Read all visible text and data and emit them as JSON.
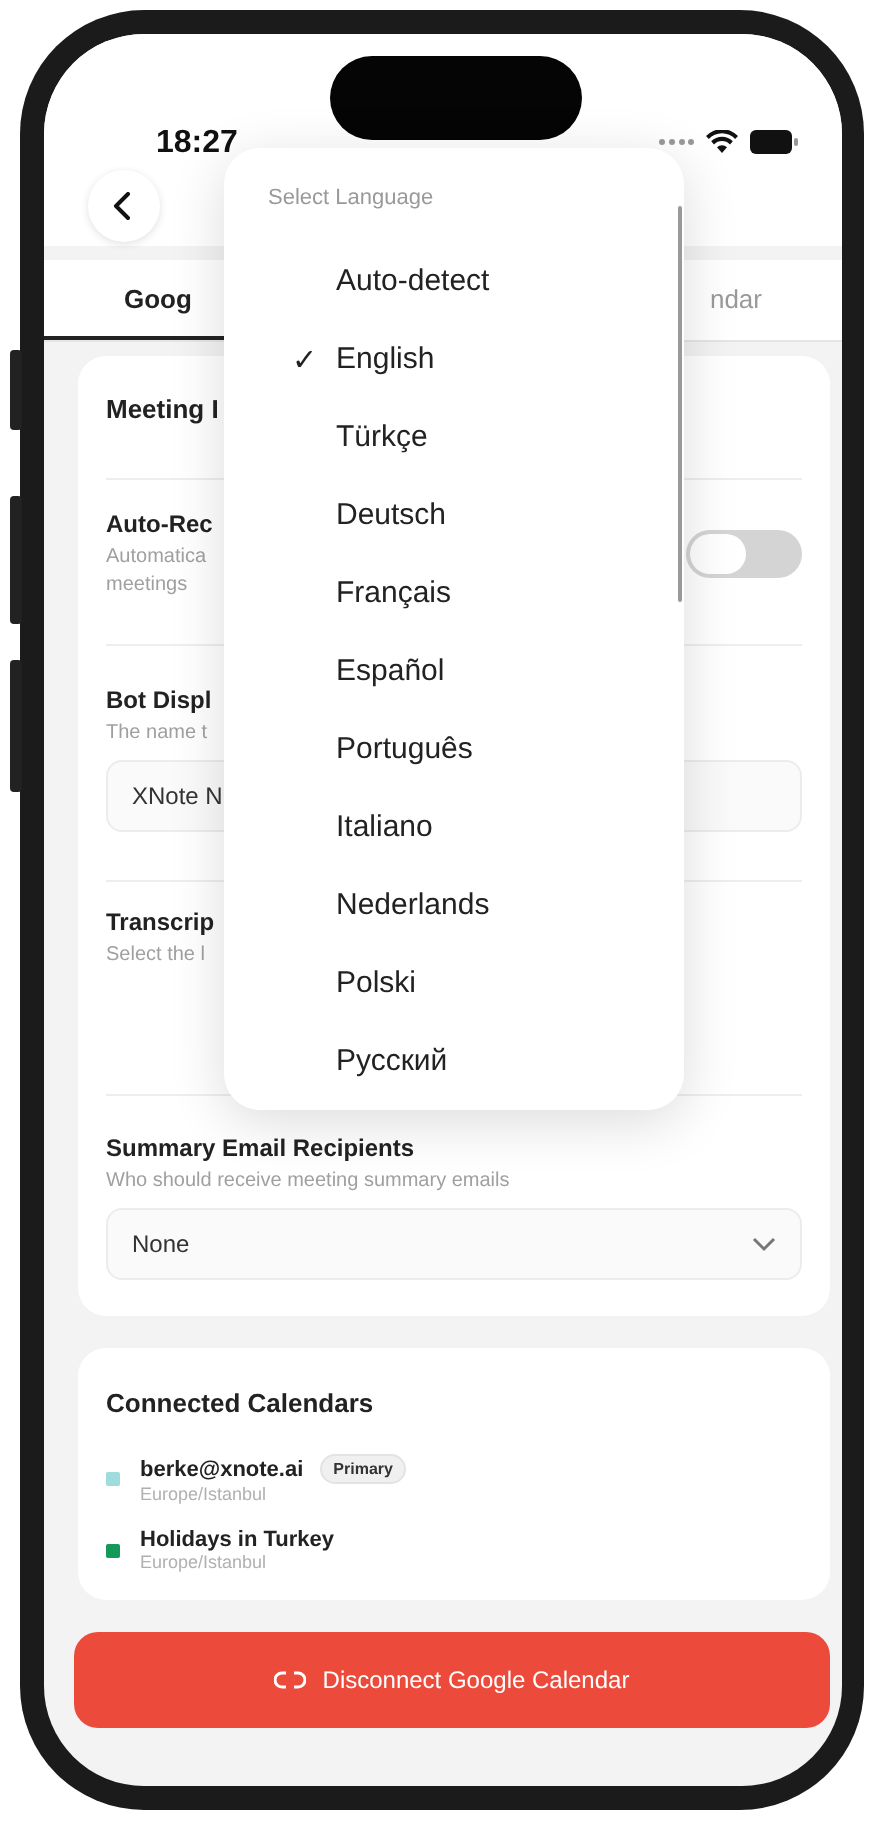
{
  "status_bar": {
    "time": "18:27"
  },
  "tabs": [
    {
      "label": "Goog",
      "selected": true
    },
    {
      "label": "ndar",
      "selected": false
    }
  ],
  "settings_card": {
    "title": "Meeting I",
    "auto_record": {
      "label": "Auto-Rec",
      "description_lines": [
        "Automatica",
        "meetings"
      ],
      "on": false
    },
    "bot_name": {
      "label": "Bot Displ",
      "description": "The name t",
      "value": "XNote N"
    },
    "transcription": {
      "label": "Transcrip",
      "description": "Select the l"
    },
    "summary": {
      "label": "Summary Email Recipients",
      "description": "Who should receive meeting summary emails",
      "value": "None"
    }
  },
  "calendars": {
    "title": "Connected Calendars",
    "items": [
      {
        "name": "berke@xnote.ai",
        "badge": "Primary",
        "timezone": "Europe/Istanbul",
        "color": "#9fdcdc"
      },
      {
        "name": "Holidays in Turkey",
        "timezone": "Europe/Istanbul",
        "color": "#14995a"
      }
    ]
  },
  "disconnect_button": {
    "label": "Disconnect Google Calendar"
  },
  "language_menu": {
    "title": "Select Language",
    "check": "✓",
    "options": [
      {
        "label": "Auto-detect",
        "selected": false
      },
      {
        "label": "English",
        "selected": true
      },
      {
        "label": "Türkçe",
        "selected": false
      },
      {
        "label": "Deutsch",
        "selected": false
      },
      {
        "label": "Français",
        "selected": false
      },
      {
        "label": "Español",
        "selected": false
      },
      {
        "label": "Português",
        "selected": false
      },
      {
        "label": "Italiano",
        "selected": false
      },
      {
        "label": "Nederlands",
        "selected": false
      },
      {
        "label": "Polski",
        "selected": false
      },
      {
        "label": "Русский",
        "selected": false
      }
    ]
  }
}
